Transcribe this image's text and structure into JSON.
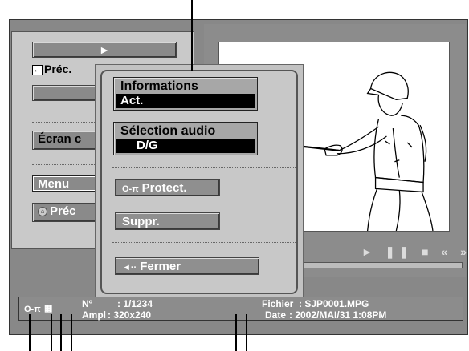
{
  "left_menu": {
    "play_symbol": "►",
    "prev_label": "Préc.",
    "prev_arrow": "←",
    "ecran_label": "Écran c",
    "menu_label": "Menu",
    "prec_btn_label": "Préc"
  },
  "preview": {
    "controls": "► ❚❚ ■ « »"
  },
  "popup": {
    "informations_title": "Informations",
    "informations_value": "Act.",
    "audio_title": "Sélection audio",
    "audio_value": "D/G",
    "protect_label": "Protect.",
    "protect_icon": "O-π",
    "suppr_label": "Suppr.",
    "close_label": "Fermer",
    "close_icon": "◄··"
  },
  "status": {
    "number_label": "Nº",
    "number_value": ": 1/1234",
    "size_label": "Ampl",
    "size_value": ": 320x240",
    "file_label": "Fichier",
    "file_value": ": SJP0001.MPG",
    "date_label": "Date",
    "date_value": ": 2002/MAI/31 1:08PM"
  },
  "colors": {
    "panel_gray": "#c9c9c9",
    "button_gray": "#8a8a8a",
    "screen_gray": "#888888",
    "highlight_black": "#000000"
  }
}
